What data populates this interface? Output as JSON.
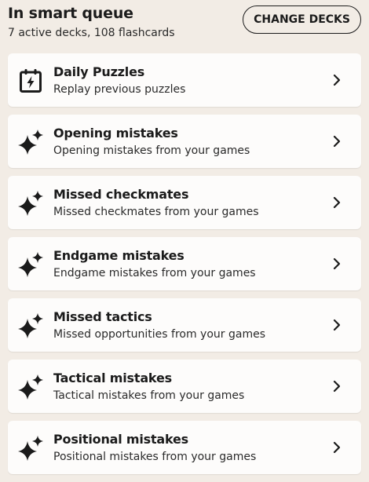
{
  "header": {
    "title": "In smart queue",
    "subtitle": "7 active decks, 108 flashcards",
    "change_decks_label": "CHANGE DECKS"
  },
  "decks": [
    {
      "title": "Daily Puzzles",
      "description": "Replay previous puzzles",
      "icon": "calendar-bolt-icon"
    },
    {
      "title": "Opening mistakes",
      "description": "Opening mistakes from your games",
      "icon": "sparkle-icon"
    },
    {
      "title": "Missed checkmates",
      "description": "Missed checkmates from your games",
      "icon": "sparkle-icon"
    },
    {
      "title": "Endgame mistakes",
      "description": "Endgame mistakes from your games",
      "icon": "sparkle-icon"
    },
    {
      "title": "Missed tactics",
      "description": "Missed opportunities from your games",
      "icon": "sparkle-icon"
    },
    {
      "title": "Tactical mistakes",
      "description": "Tactical mistakes from your games",
      "icon": "sparkle-icon"
    },
    {
      "title": "Positional mistakes",
      "description": "Positional mistakes from your games",
      "icon": "sparkle-icon"
    }
  ],
  "colors": {
    "background": "#f2ece5",
    "card": "#fdfcfb",
    "text": "#1b1b1b"
  }
}
